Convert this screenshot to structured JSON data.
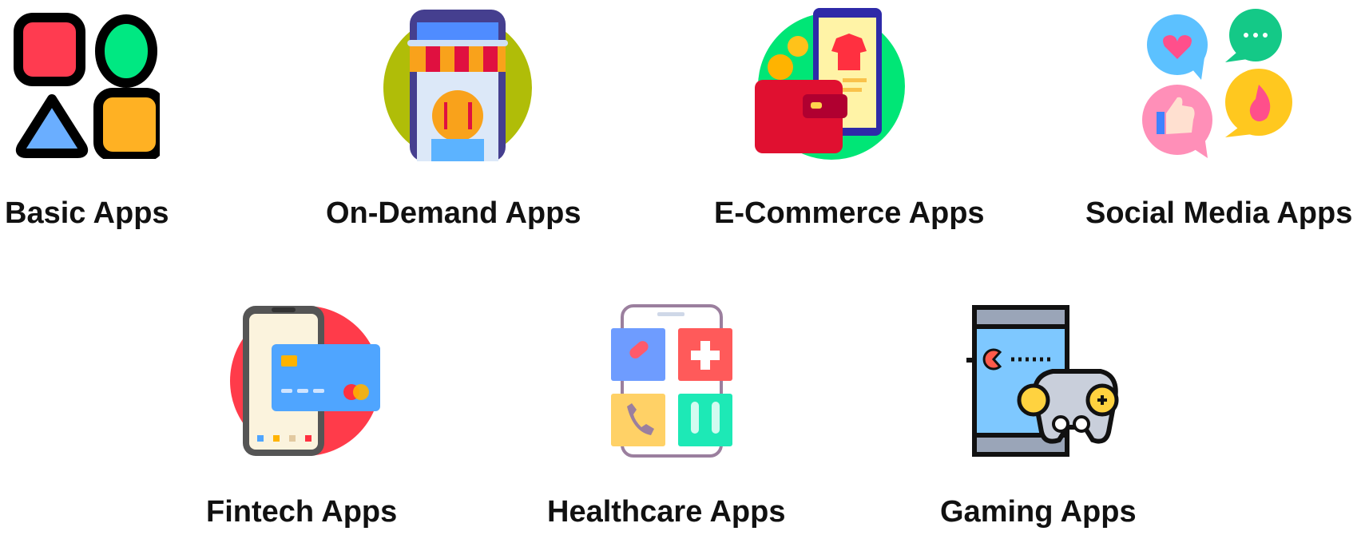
{
  "categories": [
    {
      "label": "Basic Apps",
      "icon": "basic-shapes-icon"
    },
    {
      "label": "On-Demand Apps",
      "icon": "food-store-phone-icon"
    },
    {
      "label": "E-Commerce Apps",
      "icon": "shopping-phone-wallet-icon"
    },
    {
      "label": "Social Media Apps",
      "icon": "chat-bubbles-icon"
    },
    {
      "label": "Fintech Apps",
      "icon": "phone-credit-card-icon"
    },
    {
      "label": "Healthcare Apps",
      "icon": "medical-phone-icon"
    },
    {
      "label": "Gaming Apps",
      "icon": "phone-gamepad-icon"
    }
  ]
}
